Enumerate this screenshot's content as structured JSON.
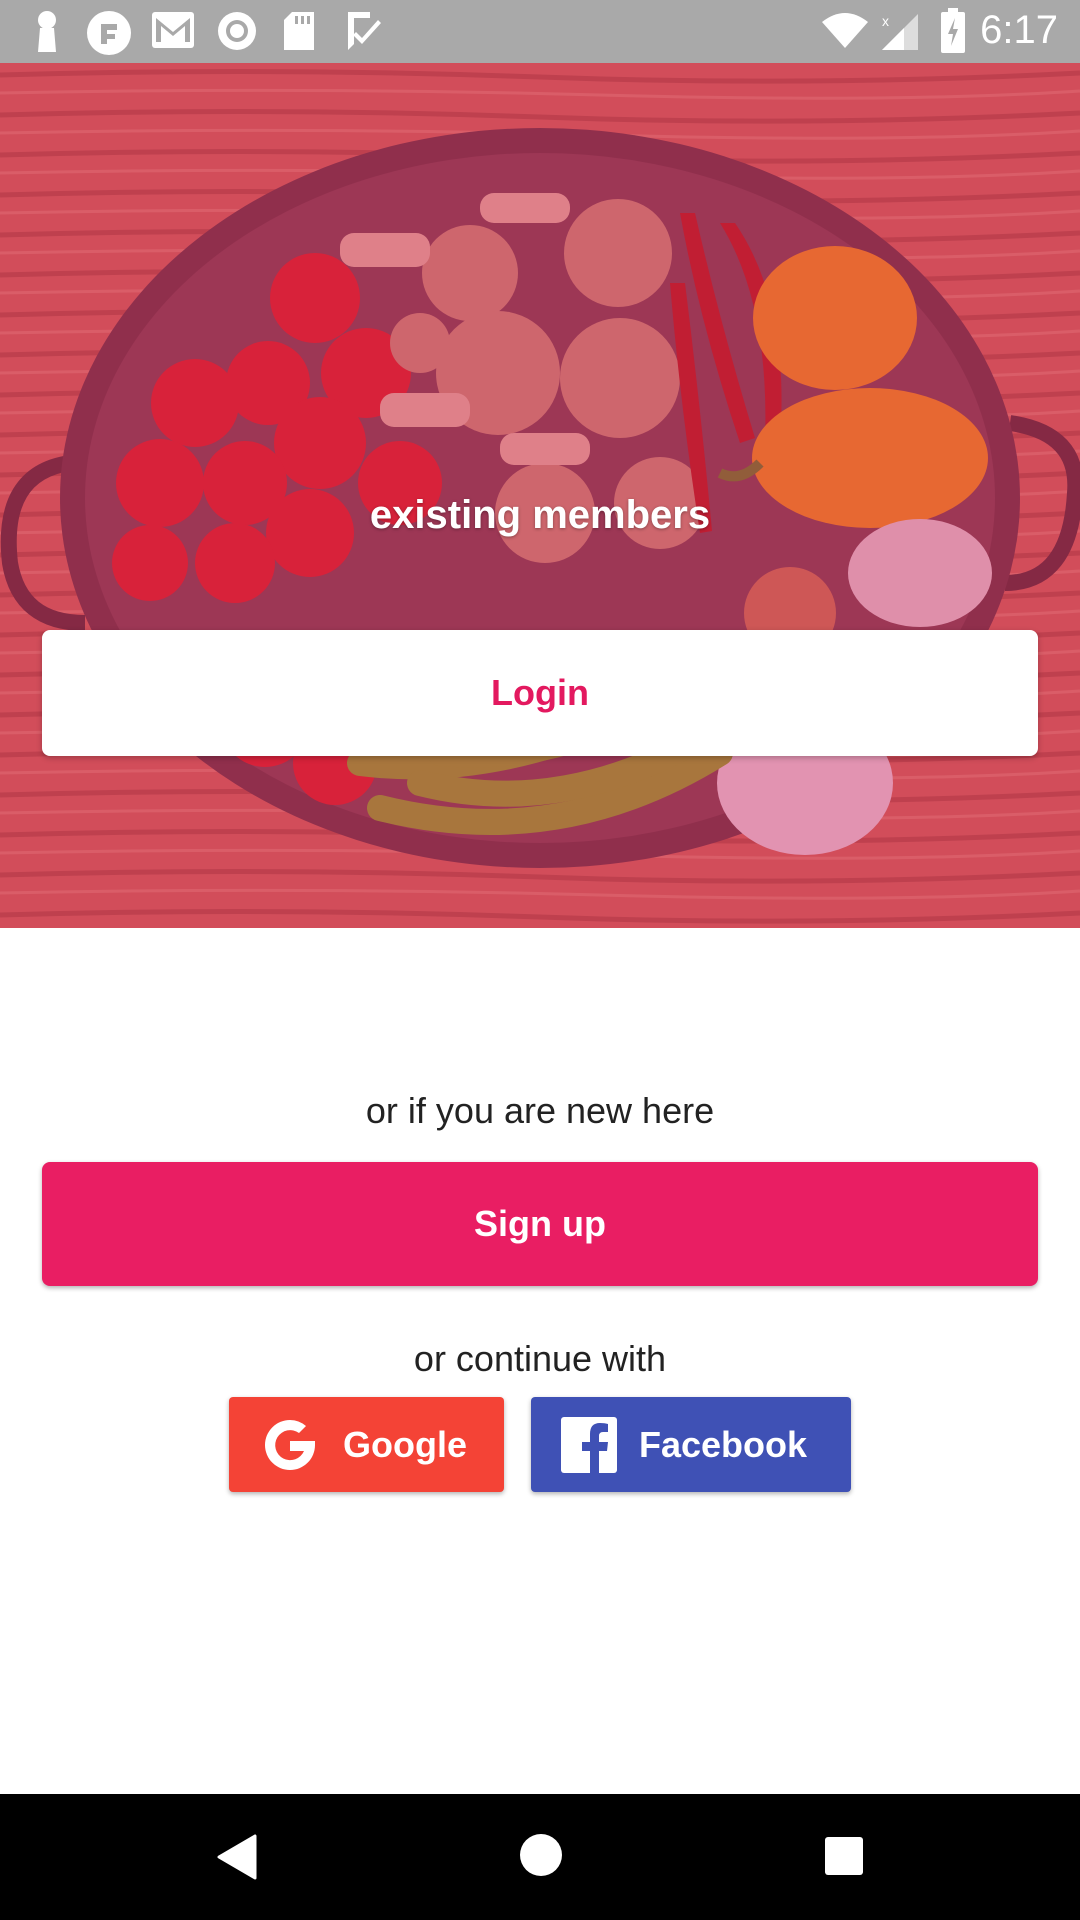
{
  "status_bar": {
    "time": "6:17",
    "left_icons": [
      "keyhole-icon",
      "app-icon",
      "gmail-icon",
      "circle-icon",
      "sd-card-icon",
      "check-icon"
    ],
    "right_icons": [
      "wifi-icon",
      "signal-icon",
      "battery-charging-icon"
    ]
  },
  "hero": {
    "image": "vegetables-pan-photo",
    "label": "existing members",
    "login_label": "Login"
  },
  "signup_section": {
    "prompt": "or if you are new here",
    "signup_label": "Sign up"
  },
  "social_section": {
    "prompt": "or continue with",
    "google_label": "Google",
    "facebook_label": "Facebook"
  },
  "navigation_bar": {
    "buttons": [
      "back-icon",
      "home-icon",
      "recents-icon"
    ]
  },
  "colors": {
    "accent": "#e91e63",
    "google": "#f44336",
    "facebook": "#3f51b5",
    "status_bar": "#a9a9a9"
  }
}
